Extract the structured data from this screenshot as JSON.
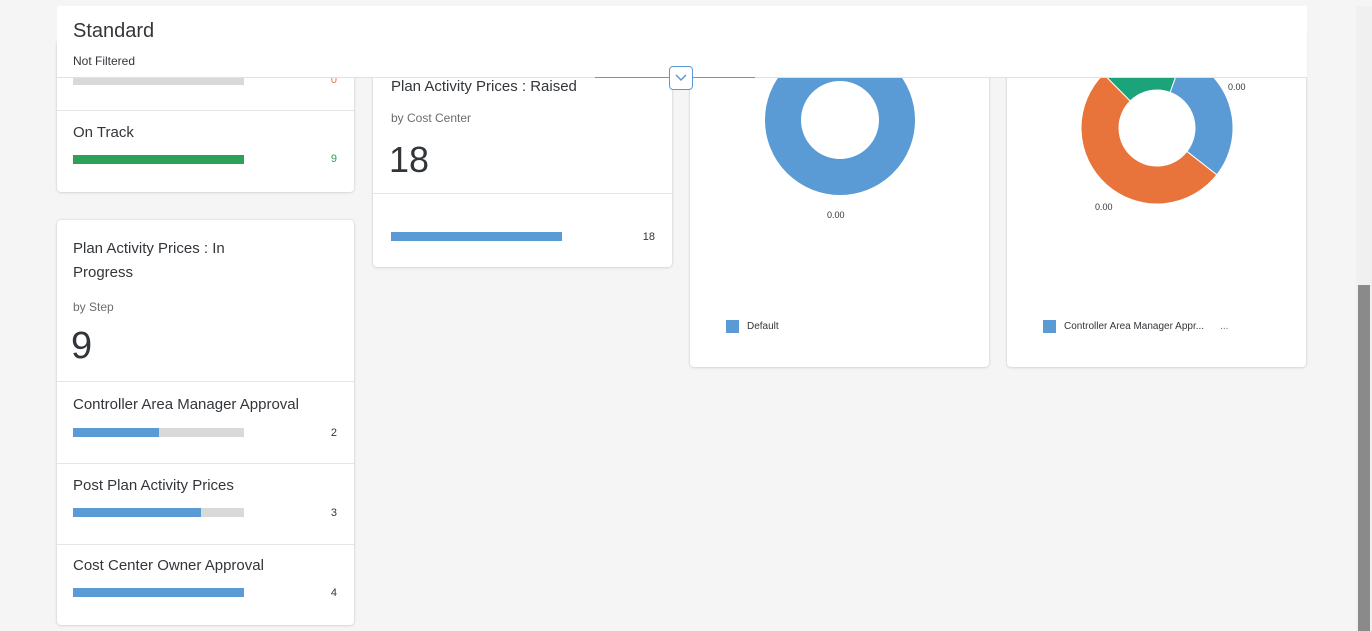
{
  "header": {
    "variant_title": "Standard",
    "filter_status": "Not Filtered"
  },
  "colors": {
    "blue": "#5b9bd5",
    "green": "#2ea05a",
    "orange": "#e8743b",
    "teal": "#1ba37a",
    "track": "#d9d9d9"
  },
  "status_card": {
    "rows": [
      {
        "label": "",
        "count": "0",
        "fraction": 0.0
      },
      {
        "label": "On Track",
        "count": "9",
        "fraction": 1.0
      }
    ]
  },
  "in_progress_card": {
    "title": "Plan Activity Prices : In Progress",
    "subtitle": "by Step",
    "kpi": "9",
    "rows": [
      {
        "label": "Controller Area Manager Approval",
        "count": "2",
        "fraction": 0.5
      },
      {
        "label": "Post Plan Activity Prices",
        "count": "3",
        "fraction": 0.75
      },
      {
        "label": "Cost Center Owner Approval",
        "count": "4",
        "fraction": 1.0
      }
    ]
  },
  "raised_card": {
    "title": "Plan Activity Prices : Raised",
    "subtitle": "by Cost Center",
    "kpi": "18",
    "row": {
      "count": "18",
      "fraction": 1.0
    }
  },
  "chart_data": [
    {
      "type": "pie",
      "donut": true,
      "labels": [
        "Default"
      ],
      "values": [
        1
      ],
      "data_labels": [
        "0.00"
      ],
      "legend": [
        "Default"
      ]
    },
    {
      "type": "pie",
      "donut": true,
      "labels": [
        "Controller Area Manager Appr...",
        "",
        ""
      ],
      "values": [
        0.3,
        0.52,
        0.18
      ],
      "data_labels": [
        "0.00",
        "0.00"
      ],
      "legend": [
        "Controller Area Manager Appr...",
        "..."
      ]
    }
  ]
}
